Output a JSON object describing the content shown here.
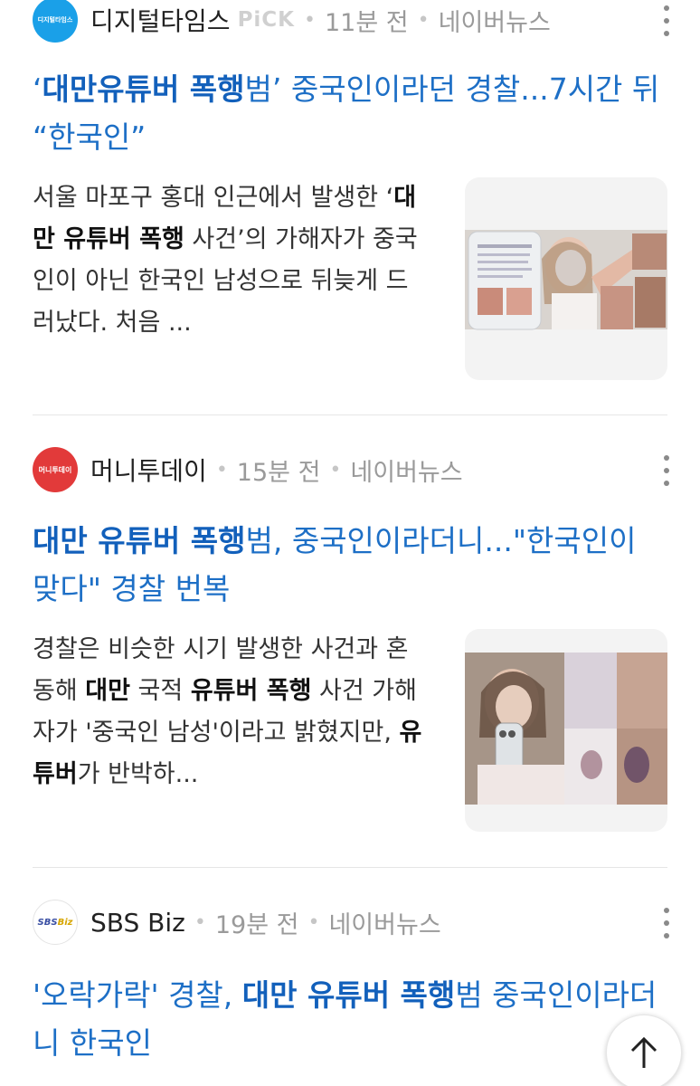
{
  "articles": [
    {
      "source": "디지털타임스",
      "logo_text": "디지털타임스",
      "pick": "PiCK",
      "time": "11분 전",
      "platform": "네이버뉴스",
      "title": {
        "q1": "‘",
        "bold1": "대만유튜버 폭행",
        "plain1": "범’ 중국인이라던 경찰...7시간 뒤 “한국인”"
      },
      "snippet": {
        "p1": "서울 마포구 홍대 인근에서 발생한 ‘",
        "b1": "대만 유튜버 폭행",
        "p2": " 사건’의 가해자가 중국인이 아닌 한국인 남성으로 뒤늦게 드러났다. 처음 ..."
      },
      "thumb_alt": "article-photo"
    },
    {
      "source": "머니투데이",
      "logo_text": "머니투데이",
      "time": "15분 전",
      "platform": "네이버뉴스",
      "title": {
        "bold1": "대만 유튜버 폭행",
        "plain1": "범, 중국인이라더니...\"한국인이 맞다\" 경찰 번복"
      },
      "snippet": {
        "p1": "경찰은 비슷한 시기 발생한 사건과 혼동해 ",
        "b1": "대만",
        "p2": " 국적 ",
        "b2": "유튜버 폭행",
        "p3": " 사건 가해자가 '중국인 남성'이라고 밝혔지만, ",
        "b3": "유튜버",
        "p4": "가 반박하..."
      },
      "thumb_alt": "article-photo"
    },
    {
      "source": "SBS Biz",
      "logo_text_1": "SBS",
      "logo_text_2": "Biz",
      "time": "19분 전",
      "platform": "네이버뉴스",
      "title": {
        "plain0": "'오락가락' 경찰, ",
        "bold1": "대만 유튜버 폭행",
        "plain1": "범 중국인이라더니 한국인"
      }
    }
  ],
  "icons": {
    "more": "kebab-icon",
    "scroll_top": "arrow-up-icon"
  },
  "colors": {
    "title_blue": "#1d6fc6",
    "divider": "#e6e6e6"
  }
}
